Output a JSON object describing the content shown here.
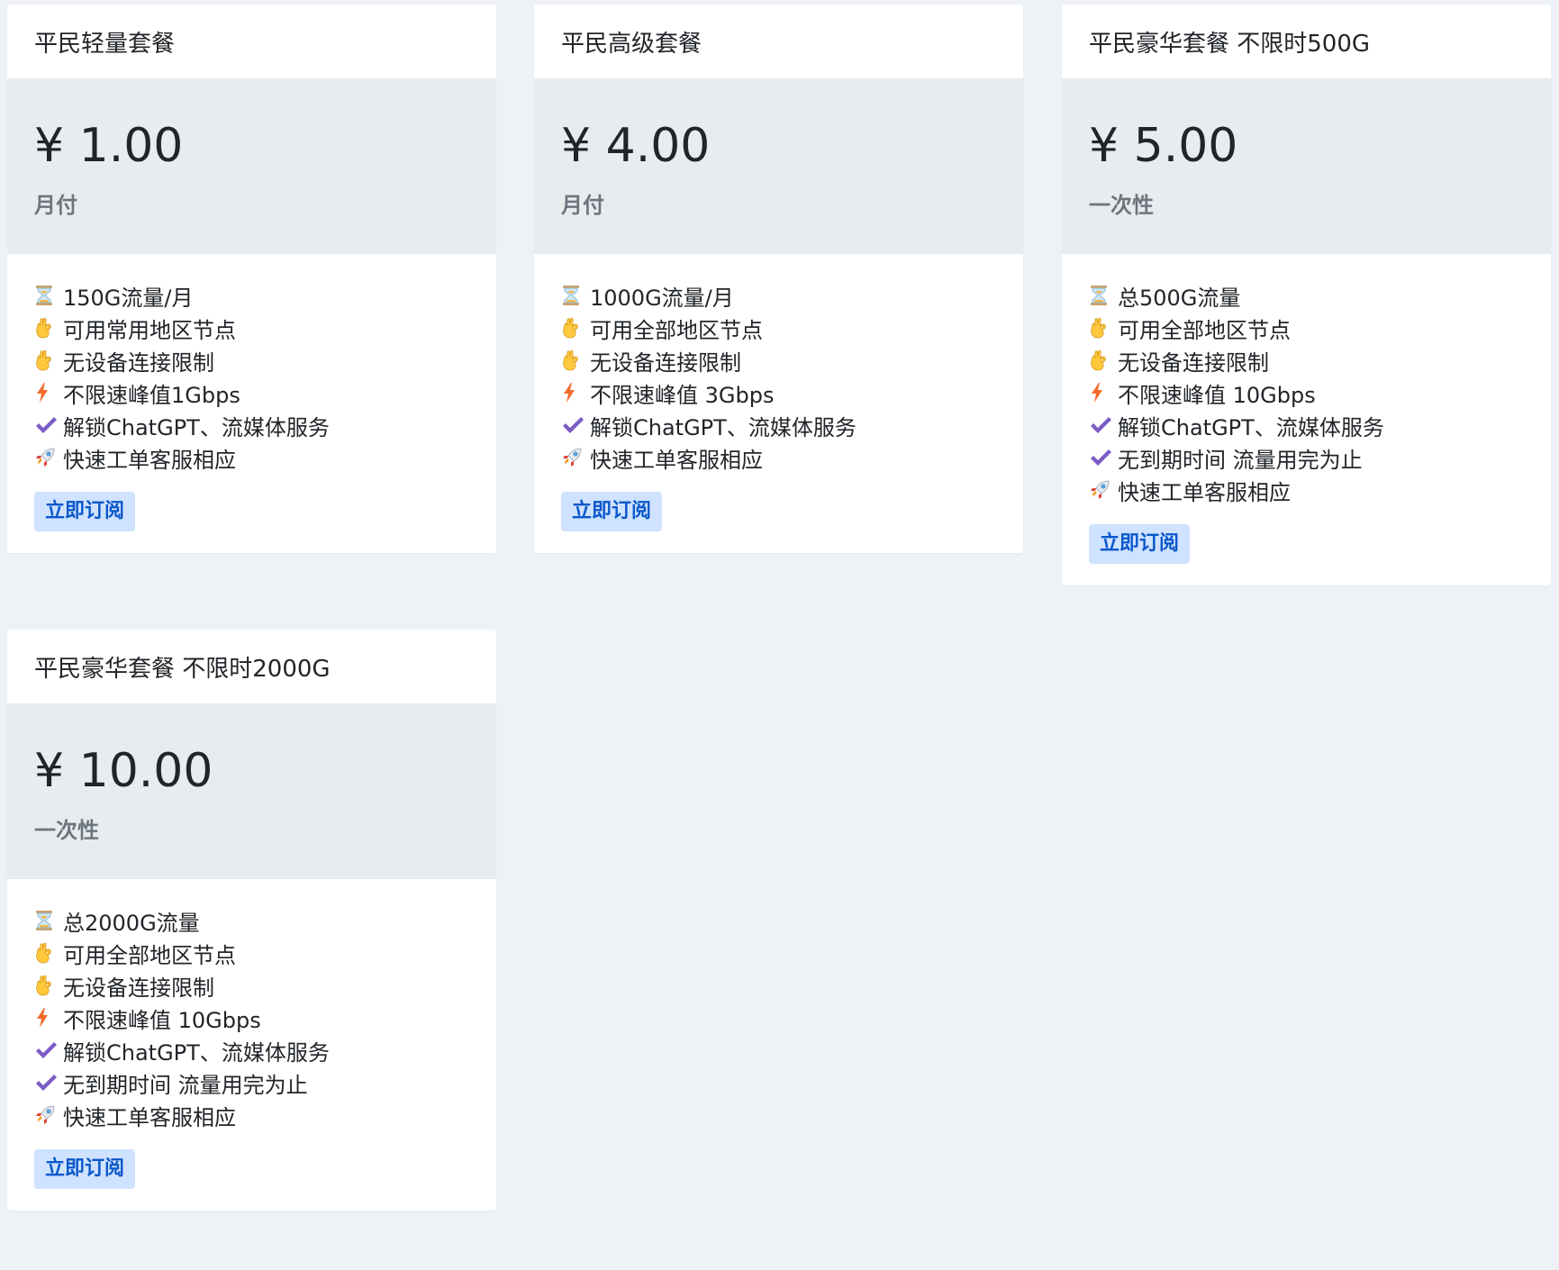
{
  "plans": [
    {
      "title": "平民轻量套餐",
      "price": "¥ 1.00",
      "period": "月付",
      "features": [
        {
          "icon": "hourglass-icon",
          "text": "150G流量/月"
        },
        {
          "icon": "ok-hand-icon",
          "text": "可用常用地区节点"
        },
        {
          "icon": "ok-hand-icon",
          "text": "无设备连接限制"
        },
        {
          "icon": "lightning-icon",
          "text": "不限速峰值1Gbps"
        },
        {
          "icon": "check-icon",
          "text": "解锁ChatGPT、流媒体服务"
        },
        {
          "icon": "rocket-icon",
          "text": "快速工单客服相应"
        }
      ],
      "button": "立即订阅"
    },
    {
      "title": "平民高级套餐",
      "price": "¥ 4.00",
      "period": "月付",
      "features": [
        {
          "icon": "hourglass-icon",
          "text": "1000G流量/月"
        },
        {
          "icon": "ok-hand-icon",
          "text": "可用全部地区节点"
        },
        {
          "icon": "ok-hand-icon",
          "text": "无设备连接限制"
        },
        {
          "icon": "lightning-icon",
          "text": "不限速峰值 3Gbps"
        },
        {
          "icon": "check-icon",
          "text": "解锁ChatGPT、流媒体服务"
        },
        {
          "icon": "rocket-icon",
          "text": "快速工单客服相应"
        }
      ],
      "button": "立即订阅"
    },
    {
      "title": "平民豪华套餐 不限时500G",
      "price": "¥ 5.00",
      "period": "一次性",
      "features": [
        {
          "icon": "hourglass-icon",
          "text": "总500G流量"
        },
        {
          "icon": "ok-hand-icon",
          "text": "可用全部地区节点"
        },
        {
          "icon": "ok-hand-icon",
          "text": "无设备连接限制"
        },
        {
          "icon": "lightning-icon",
          "text": "不限速峰值 10Gbps"
        },
        {
          "icon": "check-icon",
          "text": "解锁ChatGPT、流媒体服务"
        },
        {
          "icon": "check-icon",
          "text": "无到期时间 流量用完为止"
        },
        {
          "icon": "rocket-icon",
          "text": "快速工单客服相应"
        }
      ],
      "button": "立即订阅"
    },
    {
      "title": "平民豪华套餐 不限时2000G",
      "price": "¥ 10.00",
      "period": "一次性",
      "features": [
        {
          "icon": "hourglass-icon",
          "text": "总2000G流量"
        },
        {
          "icon": "ok-hand-icon",
          "text": "可用全部地区节点"
        },
        {
          "icon": "ok-hand-icon",
          "text": "无设备连接限制"
        },
        {
          "icon": "lightning-icon",
          "text": "不限速峰值 10Gbps"
        },
        {
          "icon": "check-icon",
          "text": "解锁ChatGPT、流媒体服务"
        },
        {
          "icon": "check-icon",
          "text": "无到期时间 流量用完为止"
        },
        {
          "icon": "rocket-icon",
          "text": "快速工单客服相应"
        }
      ],
      "button": "立即订阅"
    }
  ],
  "colors": {
    "page_bg": "#eef2f7",
    "price_bg": "#e9ecef",
    "button_bg": "#cfe2ff",
    "button_text": "#0a58ca",
    "check": "#7b5cc7",
    "lightning": "#f26b2a"
  }
}
